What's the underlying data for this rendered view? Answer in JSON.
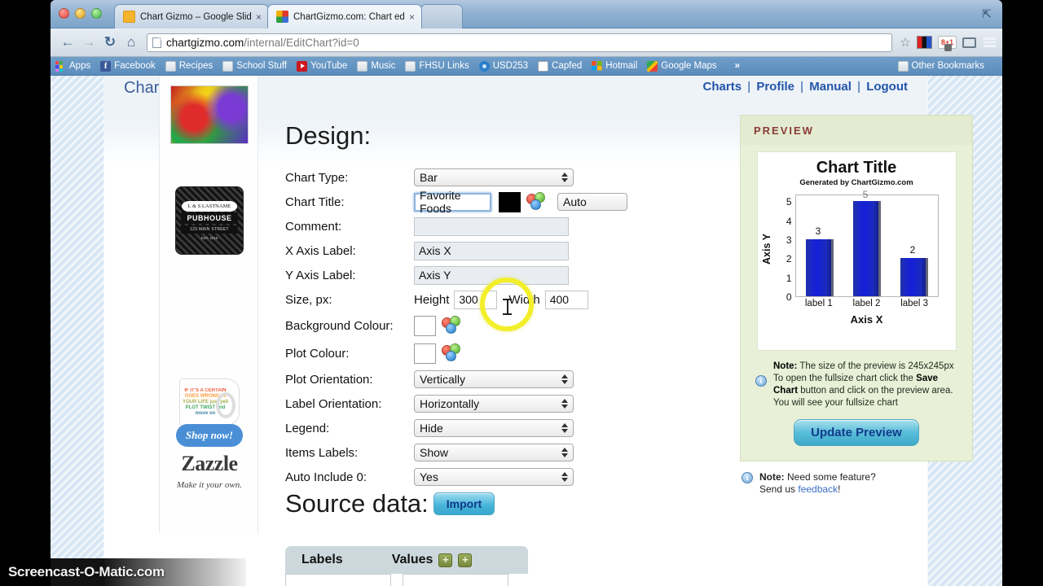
{
  "browser": {
    "tabs": [
      {
        "title": "Chart Gizmo – Google Slid",
        "close": "×",
        "active": false
      },
      {
        "title": "ChartGizmo.com: Chart ed",
        "close": "×",
        "active": true
      }
    ],
    "nav": {
      "back": "←",
      "forward": "→",
      "reload": "C",
      "home": "⌂"
    },
    "url_host": "chartgizmo.com",
    "url_path": "/internal/EditChart?id=0",
    "star": "☆",
    "ext_npy": "NPY",
    "ext_gplus": "8+1",
    "bookmarks": [
      {
        "label": "Apps",
        "icon": "apps-icon"
      },
      {
        "label": "Facebook",
        "icon": "facebook-icon"
      },
      {
        "label": "Recipes",
        "icon": "folder-icon"
      },
      {
        "label": "School Stuff",
        "icon": "folder-icon"
      },
      {
        "label": "YouTube",
        "icon": "youtube-icon"
      },
      {
        "label": "Music",
        "icon": "folder-icon"
      },
      {
        "label": "FHSU Links",
        "icon": "folder-icon"
      },
      {
        "label": "USD253",
        "icon": "usd253-icon"
      },
      {
        "label": "Capfed",
        "icon": "document-icon"
      },
      {
        "label": "Hotmail",
        "icon": "hotmail-icon"
      },
      {
        "label": "Google Maps",
        "icon": "google-maps-icon"
      }
    ],
    "bookmarks_overflow": "»",
    "other_bookmarks": "Other Bookmarks"
  },
  "site": {
    "title": "Chart Editor",
    "nav": [
      {
        "label": "Charts"
      },
      {
        "label": "Profile"
      },
      {
        "label": "Manual"
      },
      {
        "label": "Logout"
      }
    ],
    "nav_separator": "|"
  },
  "design": {
    "heading": "Design:",
    "fields": {
      "chart_type": {
        "label": "Chart Type:",
        "value": "Bar"
      },
      "chart_title": {
        "label": "Chart Title:",
        "value": "Favorite Foods",
        "swatch": "#000000",
        "font_size": "Auto"
      },
      "comment": {
        "label": "Comment:",
        "value": ""
      },
      "x_axis_label": {
        "label": "X Axis Label:",
        "value": "Axis X"
      },
      "y_axis_label": {
        "label": "Y Axis Label:",
        "value": "Axis Y"
      },
      "size": {
        "label": "Size, px:",
        "height_label": "Height",
        "height": "300",
        "width_label": "Width",
        "width": "400"
      },
      "background_colour": {
        "label": "Background Colour:",
        "swatch": "#ffffff"
      },
      "plot_colour": {
        "label": "Plot Colour:",
        "swatch": "#ffffff"
      },
      "plot_orientation": {
        "label": "Plot Orientation:",
        "value": "Vertically"
      },
      "label_orientation": {
        "label": "Label Orientation:",
        "value": "Horizontally"
      },
      "legend": {
        "label": "Legend:",
        "value": "Hide"
      },
      "items_labels": {
        "label": "Items Labels:",
        "value": "Show"
      },
      "auto_include_0": {
        "label": "Auto Include 0:",
        "value": "Yes"
      }
    }
  },
  "source_data": {
    "heading": "Source data:",
    "import_label": "Import",
    "columns": {
      "labels": "Labels",
      "values": "Values"
    },
    "add_value_button": "+",
    "add_row_button": "+"
  },
  "preview": {
    "header": "PREVIEW",
    "note_1": {
      "bold": "Note:",
      "text": " The size of the preview is 245x245px"
    },
    "note_2_parts": [
      "To open the fullsize chart click the ",
      "Save Chart",
      " button and click on the preview area. You will see your fullsize chart"
    ],
    "update_button": "Update Preview",
    "feedback_note": {
      "bold": "Note:",
      "text": " Need some feature?",
      "line2_prefix": "Send us ",
      "link": "feedback",
      "line2_suffix": "!"
    }
  },
  "chart_data": {
    "type": "bar",
    "title": "Chart Title",
    "subtitle": "Generated by ChartGizmo.com",
    "categories": [
      "label 1",
      "label 2",
      "label 3"
    ],
    "values": [
      3,
      5,
      2
    ],
    "value_labels": [
      "3",
      "5",
      "2"
    ],
    "xlabel": "Axis X",
    "ylabel": "Axis Y",
    "yticks": [
      "0",
      "1",
      "2",
      "3",
      "4",
      "5"
    ],
    "ylim": [
      0,
      5.4
    ],
    "grid": false,
    "legend": "hidden",
    "bar_color": "#1a28c8"
  },
  "ads": {
    "pub_plate": "L & S LASTNAME",
    "pub_name": "PUBHOUSE",
    "pub_addr": "123 MAIN STREET",
    "pub_fine": "EST. 2015",
    "mug_text": "IF IT'S A CERTAIN GOES WRONG IN YOUR LIFE just yell PLOT TWIST and move on",
    "shop_now": "Shop now!",
    "brand": "Zazzle",
    "tagline": "Make it your own."
  },
  "watermark": {
    "text": "Screencast-O-Matic.com"
  }
}
